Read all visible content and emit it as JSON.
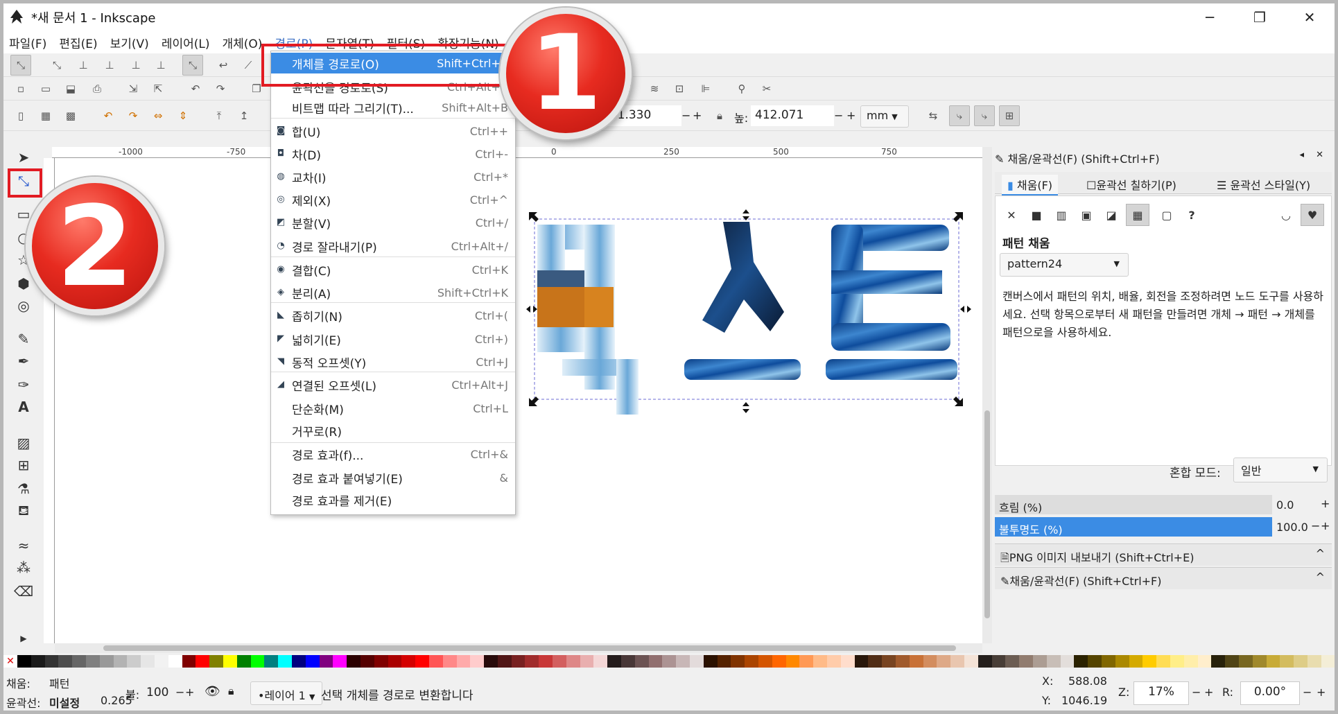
{
  "window": {
    "title": "*새 문서 1 - Inkscape",
    "minimize": "─",
    "maximize": "❐",
    "close": "✕"
  },
  "menubar": [
    "파일(F)",
    "편집(E)",
    "보기(V)",
    "레이어(L)",
    "개체(O)",
    "경로(P)",
    "문자열(T)",
    "필터(S)",
    "확장기능(N)"
  ],
  "toolbar": {
    "w_value": "961.330",
    "h_label": "높:",
    "h_value": "412.071",
    "unit": "mm",
    "minus": "−",
    "plus": "+"
  },
  "ruler": {
    "ticks": [
      "-1000",
      "-750",
      "0",
      "250",
      "500",
      "750"
    ]
  },
  "path_menu": {
    "items": [
      {
        "label": "개체를 경로로(O)",
        "shortcut": "Shift+Ctrl+C",
        "icon": "",
        "highlighted": true
      },
      {
        "label": "윤곽선을 경로로(S)",
        "shortcut": "Ctrl+Alt+C",
        "icon": ""
      },
      {
        "label": "비트맵 따라 그리기(T)...",
        "shortcut": "Shift+Alt+B",
        "icon": ""
      },
      {
        "label": "합(U)",
        "shortcut": "Ctrl++",
        "icon": "union-icon"
      },
      {
        "label": "차(D)",
        "shortcut": "Ctrl+-",
        "icon": "difference-icon"
      },
      {
        "label": "교차(I)",
        "shortcut": "Ctrl+*",
        "icon": "intersection-icon"
      },
      {
        "label": "제외(X)",
        "shortcut": "Ctrl+^",
        "icon": "exclusion-icon"
      },
      {
        "label": "분할(V)",
        "shortcut": "Ctrl+/",
        "icon": "division-icon"
      },
      {
        "label": "경로 잘라내기(P)",
        "shortcut": "Ctrl+Alt+/",
        "icon": "cut-path-icon"
      },
      {
        "label": "결합(C)",
        "shortcut": "Ctrl+K",
        "icon": "combine-icon"
      },
      {
        "label": "분리(A)",
        "shortcut": "Shift+Ctrl+K",
        "icon": "break-apart-icon"
      },
      {
        "label": "좁히기(N)",
        "shortcut": "Ctrl+(",
        "icon": "inset-icon"
      },
      {
        "label": "넓히기(E)",
        "shortcut": "Ctrl+)",
        "icon": "outset-icon"
      },
      {
        "label": "동적 오프셋(Y)",
        "shortcut": "Ctrl+J",
        "icon": "dynamic-offset-icon"
      },
      {
        "label": "연결된 오프셋(L)",
        "shortcut": "Ctrl+Alt+J",
        "icon": "linked-offset-icon"
      },
      {
        "label": "단순화(M)",
        "shortcut": "Ctrl+L",
        "icon": ""
      },
      {
        "label": "거꾸로(R)",
        "shortcut": "",
        "icon": ""
      },
      {
        "label": "경로 효과(f)...",
        "shortcut": "Ctrl+&",
        "icon": ""
      },
      {
        "label": "경로 효과 붙여넣기(E)",
        "shortcut": "&",
        "icon": ""
      },
      {
        "label": "경로 효과를 제거(E)",
        "shortcut": "",
        "icon": ""
      }
    ]
  },
  "canvas": {
    "text": "텍스트"
  },
  "annotations": {
    "badge1": "1",
    "badge2": "2"
  },
  "dock": {
    "title": "채움/윤곽선(F) (Shift+Ctrl+F)",
    "tabs": [
      "채움(F)",
      "윤곽선 칠하기(P)",
      "윤곽선 스타일(Y)"
    ],
    "paint_buttons": [
      "✕",
      "?"
    ],
    "section_title": "패턴 채움",
    "pattern_name": "pattern24",
    "help_text": "캔버스에서 패턴의 위치, 배율, 회전을 조정하려면 노드 도구를 사용하세요. 선택 항목으로부터 새 패턴을 만들려면 개체 → 패턴 → 개체를 패턴으로을 사용하세요.",
    "blend_label": "혼합 모드:",
    "blend_value": "일반",
    "blur_label": "흐림 (%)",
    "blur_value": "0.0",
    "opacity_label": "불투명도 (%)",
    "opacity_value": "100.0",
    "png_panel": "PNG 이미지 내보내기 (Shift+Ctrl+E)",
    "fill_panel": "채움/윤곽선(F) (Shift+Ctrl+F)",
    "chevron": "^"
  },
  "status": {
    "fill_label": "채움:",
    "fill_value": "패턴",
    "stroke_label": "윤곽선:",
    "stroke_value": "미설정",
    "stroke_width": "0.265",
    "opacity_label": "불:",
    "opacity_value": "100",
    "layer": "•레이어 1",
    "message": "선택 개체를 경로로 변환합니다",
    "x_label": "X:",
    "x_value": "588.08",
    "y_label": "Y:",
    "y_value": "1046.19",
    "zoom_label": "Z:",
    "zoom_value": "17%",
    "rot_label": "R:",
    "rot_value": "0.00°"
  },
  "colors": {
    "highlight": "#3b8ce4",
    "annotation_red": "#e21b23"
  }
}
